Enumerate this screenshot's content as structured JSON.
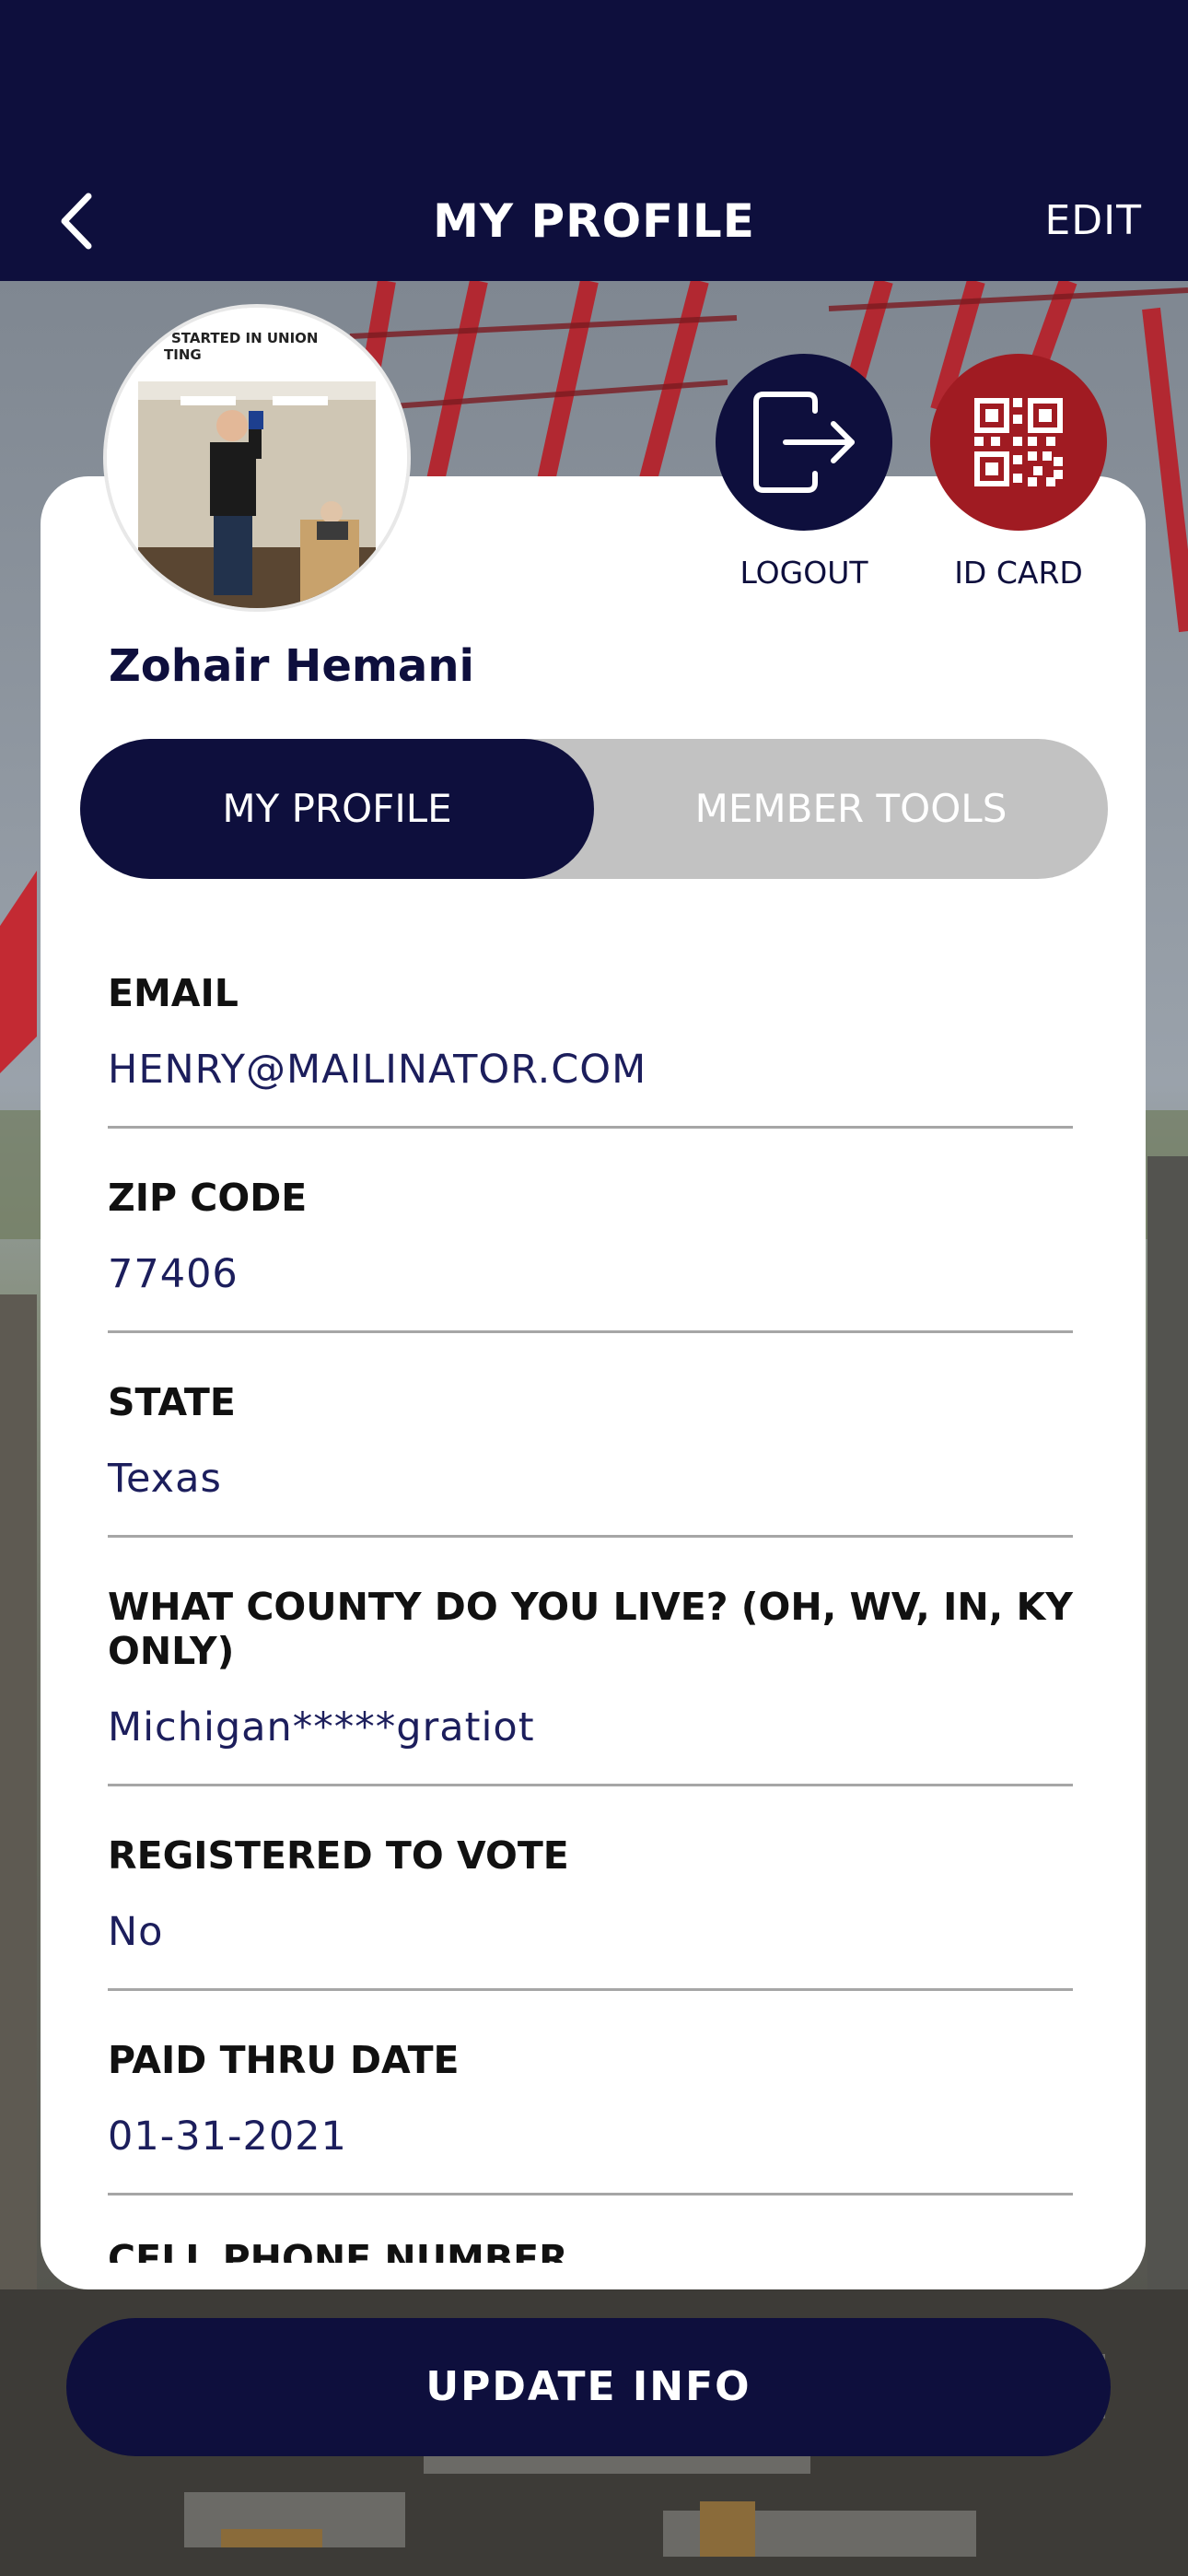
{
  "header": {
    "title": "MY PROFILE",
    "edit_label": "EDIT"
  },
  "avatar": {
    "caption_line1": "STARTED IN UNION",
    "caption_line2": "TING"
  },
  "actions": {
    "logout_label": "LOGOUT",
    "id_card_label": "ID CARD"
  },
  "user": {
    "name": "Zohair Hemani"
  },
  "tabs": [
    {
      "label": "MY PROFILE",
      "active": true
    },
    {
      "label": "MEMBER TOOLS",
      "active": false
    }
  ],
  "fields": [
    {
      "label": "EMAIL",
      "value": "HENRY@MAILINATOR.COM"
    },
    {
      "label": "ZIP CODE",
      "value": "77406"
    },
    {
      "label": "STATE",
      "value": "Texas"
    },
    {
      "label": "WHAT COUNTY DO YOU LIVE? (OH, WV, IN, KY ONLY)",
      "value": "Michigan*****gratiot"
    },
    {
      "label": "REGISTERED TO VOTE",
      "value": "No"
    },
    {
      "label": "PAID THRU DATE",
      "value": "01-31-2021"
    },
    {
      "label": "CELL PHONE NUMBER",
      "value": ""
    }
  ],
  "footer": {
    "update_label": "UPDATE INFO"
  },
  "colors": {
    "navy": "#0e0f3d",
    "id_card_red": "#a01b22",
    "tab_inactive": "#c2c2c2",
    "value_text": "#1c1e5c"
  }
}
